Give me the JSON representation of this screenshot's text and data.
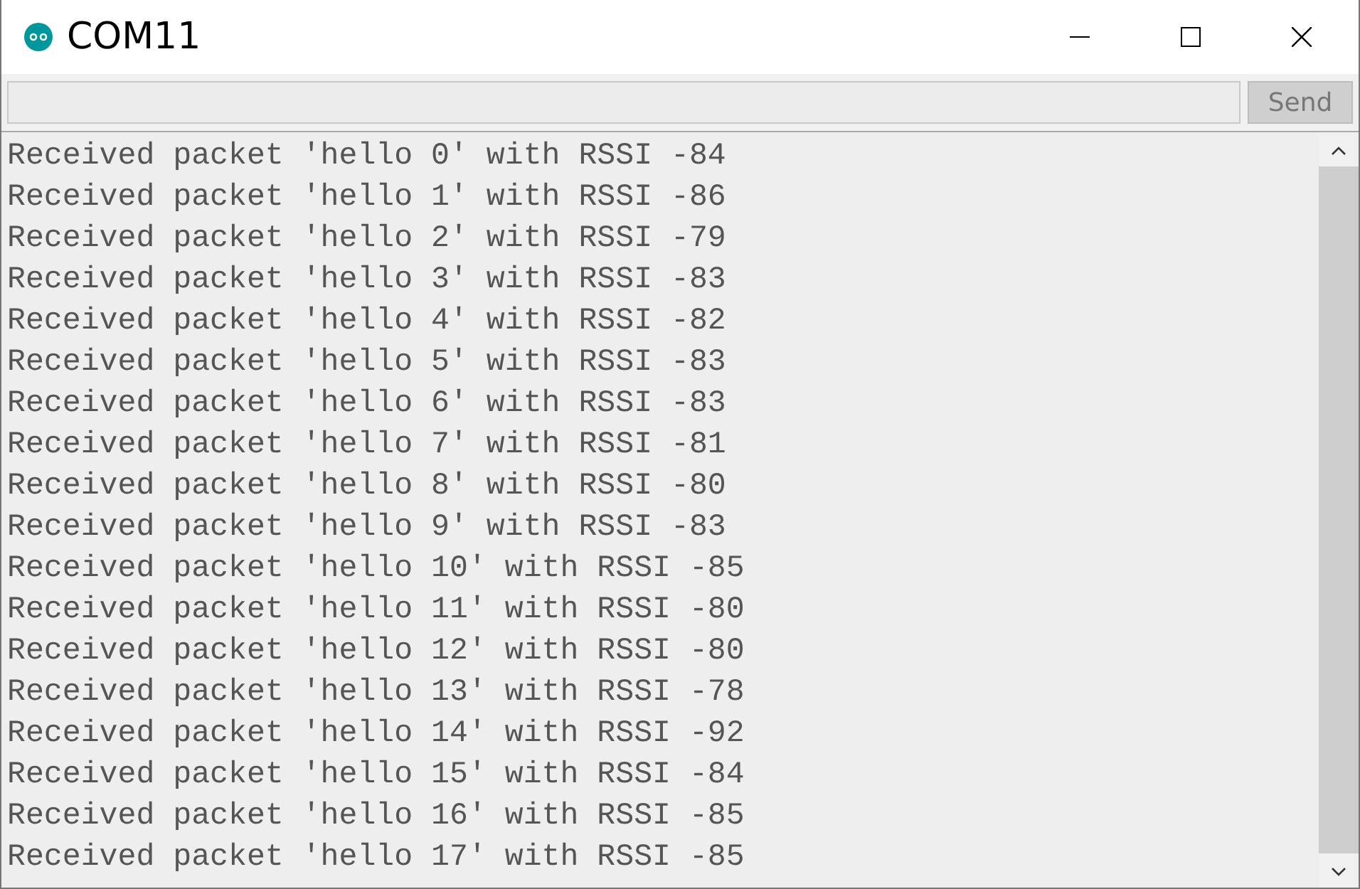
{
  "window": {
    "title": "COM11"
  },
  "input": {
    "button": "Send"
  },
  "lines": [
    "Received packet 'hello 0' with RSSI -84",
    "Received packet 'hello 1' with RSSI -86",
    "Received packet 'hello 2' with RSSI -79",
    "Received packet 'hello 3' with RSSI -83",
    "Received packet 'hello 4' with RSSI -82",
    "Received packet 'hello 5' with RSSI -83",
    "Received packet 'hello 6' with RSSI -83",
    "Received packet 'hello 7' with RSSI -81",
    "Received packet 'hello 8' with RSSI -80",
    "Received packet 'hello 9' with RSSI -83",
    "Received packet 'hello 10' with RSSI -85",
    "Received packet 'hello 11' with RSSI -80",
    "Received packet 'hello 12' with RSSI -80",
    "Received packet 'hello 13' with RSSI -78",
    "Received packet 'hello 14' with RSSI -92",
    "Received packet 'hello 15' with RSSI -84",
    "Received packet 'hello 16' with RSSI -85",
    "Received packet 'hello 17' with RSSI -85"
  ]
}
